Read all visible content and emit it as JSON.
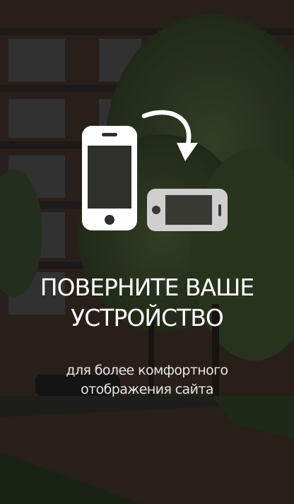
{
  "notice": {
    "heading_line1": "ПОВЕРНИТЕ ВАШЕ",
    "heading_line2": "УСТРОЙСТВО",
    "subtext_line1": "для более комфортного",
    "subtext_line2": "отображения сайта"
  },
  "icons": {
    "portrait_phone": "phone-portrait-icon",
    "landscape_phone": "phone-landscape-icon",
    "rotate_arrow": "rotate-arrow-icon"
  },
  "colors": {
    "text_primary": "#ffffff",
    "text_secondary": "#e6e6e6",
    "icon_primary": "#ffffff",
    "icon_secondary": "#cfcfcf"
  }
}
